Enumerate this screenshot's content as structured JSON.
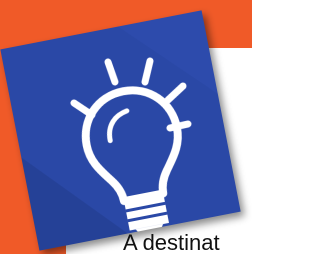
{
  "colors": {
    "accent": "#f05a28",
    "tile": "#2a48a6",
    "icon": "#ffffff"
  },
  "icon": {
    "name": "lightbulb-icon"
  },
  "caption": {
    "text": "A destinat"
  }
}
